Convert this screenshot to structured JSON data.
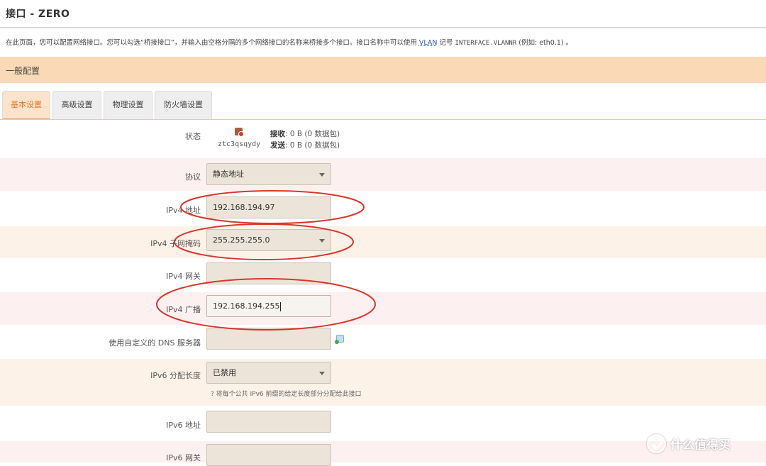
{
  "title": "接口 - ZERO",
  "description": {
    "before": "在此页面，您可以配置网络接口。您可以勾选“桥接接口”，并输入由空格分隔的多个网络接口的名称来桥接多个接口。接口名称中可以使用 ",
    "vlan": "VLAN",
    "middle": " 记号 ",
    "code": "INTERFACE.VLANNR",
    "after": " (例如: eth0.1) 。"
  },
  "section_title": "一般配置",
  "tabs": [
    {
      "label": "基本设置",
      "active": true
    },
    {
      "label": "高级设置",
      "active": false
    },
    {
      "label": "物理设置",
      "active": false
    },
    {
      "label": "防火墙设置",
      "active": false
    }
  ],
  "status": {
    "label": "状态",
    "icon": "network-status-icon",
    "interface": "ztc3qsqydy",
    "rx_label": "接收",
    "rx_value": ": 0 B (0 数据包)",
    "tx_label": "发送",
    "tx_value": ": 0 B (0 数据包)"
  },
  "fields": {
    "protocol": {
      "label": "协议",
      "value": "静态地址"
    },
    "ipv4_address": {
      "label": "IPv4 地址",
      "value": "192.168.194.97"
    },
    "ipv4_netmask": {
      "label": "IPv4 子网掩码",
      "value": "255.255.255.0"
    },
    "ipv4_gateway": {
      "label": "IPv4 网关",
      "value": ""
    },
    "ipv4_broadcast": {
      "label": "IPv4 广播",
      "value": "192.168.194.255"
    },
    "dns": {
      "label": "使用自定义的 DNS 服务器",
      "value": ""
    },
    "ipv6_assign": {
      "label": "IPv6 分配长度",
      "value": "已禁用",
      "hint": "将每个公共 IPv6 前缀的给定长度部分分配给此接口"
    },
    "ipv6_address": {
      "label": "IPv6 地址",
      "value": ""
    },
    "ipv6_gateway": {
      "label": "IPv6 网关",
      "value": ""
    }
  },
  "annotation_color": "#d9362b",
  "watermark": "什么值得买"
}
